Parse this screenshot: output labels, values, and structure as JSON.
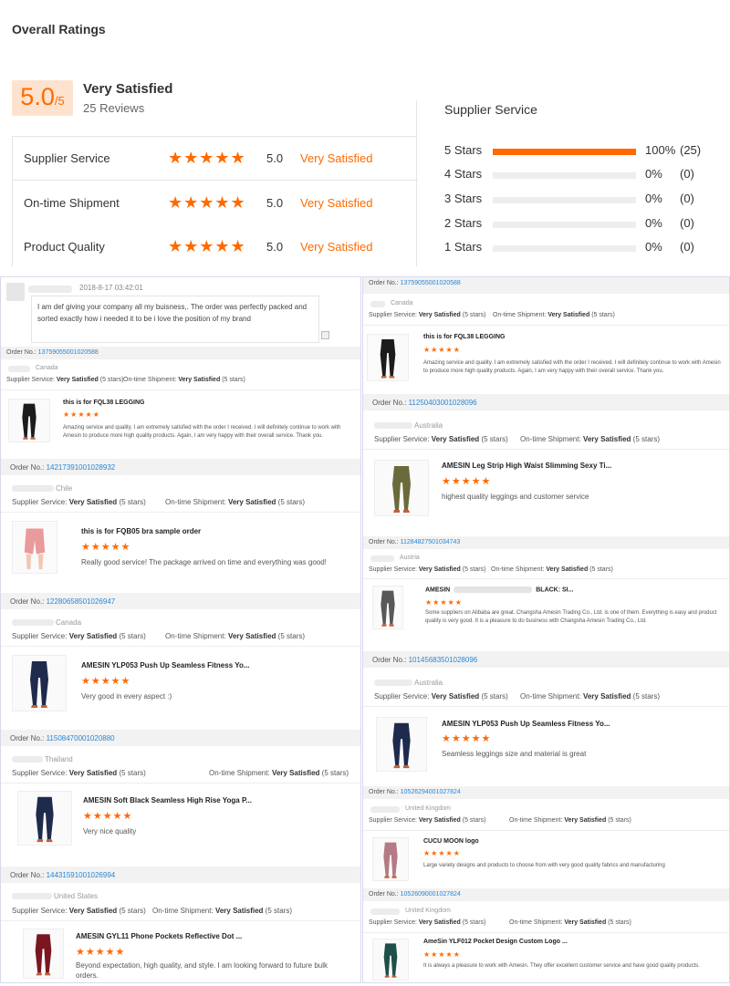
{
  "summary": {
    "title": "Overall Ratings",
    "score": "5.0",
    "score_suffix": "/5",
    "label": "Very Satisfied",
    "reviews": "25 Reviews",
    "ratings": [
      {
        "label": "Supplier Service",
        "stars": "★★★★★",
        "score": "5.0",
        "satisfaction": "Very Satisfied"
      },
      {
        "label": "On-time Shipment",
        "stars": "★★★★★",
        "score": "5.0",
        "satisfaction": "Very Satisfied"
      },
      {
        "label": "Product Quality",
        "stars": "★★★★★",
        "score": "5.0",
        "satisfaction": "Very Satisfied"
      }
    ],
    "accent_color": "#ff6a00"
  },
  "distribution": {
    "title": "Supplier Service",
    "rows": [
      {
        "label": "5 Stars",
        "percent": "100%",
        "count": "(25)",
        "fill": 1.0
      },
      {
        "label": "4 Stars",
        "percent": "0%",
        "count": "(0)",
        "fill": 0
      },
      {
        "label": "3 Stars",
        "percent": "0%",
        "count": "(0)",
        "fill": 0
      },
      {
        "label": "2 Stars",
        "percent": "0%",
        "count": "(0)",
        "fill": 0
      },
      {
        "label": "1 Stars",
        "percent": "0%",
        "count": "(0)",
        "fill": 0
      }
    ]
  },
  "top_review": {
    "date": "2018-8-17 03:42:01",
    "text": "I am def giving your company all my buisness,. The order was perfectly packed and sorted exactly how i needed it to be i love the position of my brand"
  },
  "common": {
    "order_label": "Order No.:",
    "supplier_label": "Supplier Service:",
    "shipment_label": "On-time Shipment:",
    "very_satisfied": "Very Satisfied",
    "five_stars": "(5 stars)",
    "stars": "★★★★★"
  },
  "left_orders": [
    {
      "order_no": "13759055001020588",
      "country": "Canada",
      "title": "this is for FQL38 LEGGING",
      "text": "Amazing service and quality. I am extremely satisfied with the order I received. I will definitely continue to work with Amesin to produce more high quality products. Again, I am very happy with their overall service. Thank you.",
      "image": "black-legging-icon"
    },
    {
      "order_no": "14217391001028932",
      "country": "Chile",
      "title": "this is for FQB05 bra sample order",
      "text": "Really good service! The package arrived on time and everything was good!",
      "image": "pink-shorts-icon"
    },
    {
      "order_no": "12280658501026947",
      "country": "Canada",
      "title": "AMESIN YLP053 Push Up Seamless Fitness Yo...",
      "text": "Very good in every aspect :)",
      "image": "navy-legging-icon"
    },
    {
      "order_no": "11508470001020880",
      "country": "Thailand",
      "title": "AMESIN Soft Black Seamless High Rise Yoga P...",
      "text": "Very nice quality",
      "image": "navy-legging-icon"
    },
    {
      "order_no": "14431591001026994",
      "country": "United States",
      "title": "AMESIN GYL11 Phone Pockets Reflective Dot ...",
      "text": "Beyond expectation, high quality, and style. I am looking forward to future bulk orders.",
      "image": "red-legging-icon"
    }
  ],
  "right_orders": [
    {
      "order_no": "13759055001020588",
      "country": "Canada",
      "title": "this is for FQL38 LEGGING",
      "text": "Amazing service and quality. I am extremely satisfied with the order I received. I will definitely continue to work with Amesin to produce more high quality products. Again, I am very happy with their overall service. Thank you.",
      "image": "black-legging-icon"
    },
    {
      "order_no": "11250403001028096",
      "country": "Australia",
      "title": "AMESIN Leg Strip High Waist Slimming Sexy Ti...",
      "text": "highest quality leggings and customer service",
      "image": "olive-legging-icon"
    },
    {
      "order_no": "11284827501034743",
      "country": "Austria",
      "title_prefix": "AMESIN",
      "title_suffix": "BLACK: SI...",
      "text": "Some suppliers on Alibaba are great. Changsha Amesin Trading Co., Ltd. is one of them. Everything is easy and product quality is very good. It is a pleasure to do business with Changsha Amesin Trading Co., Ltd.",
      "image": "grey-legging-icon"
    },
    {
      "order_no": "10145683501028096",
      "country": "Australia",
      "title": "AMESIN YLP053 Push Up Seamless Fitness Yo...",
      "text": "Seamless leggings size and material is great",
      "image": "navy-legging-icon"
    },
    {
      "order_no": "10526294001027824",
      "country": "United Kingdom",
      "title": "CUCU MOON logo",
      "text": "Large variety designs and products to choose from with very good quality fabrics and manufacturing",
      "image": "mauve-legging-icon"
    },
    {
      "order_no": "10526090001027824",
      "country": "United Kingdom",
      "title": "AmeSin YLF012 Pocket Design Custom Logo ...",
      "text": "It is always a pleasure to work with Amesin. They offer excellent customer service and have good quality products.",
      "image": "teal-legging-icon"
    }
  ]
}
